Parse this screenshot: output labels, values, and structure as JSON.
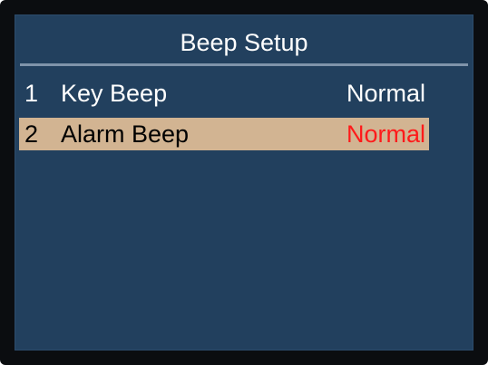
{
  "screen": {
    "title": "Beep Setup"
  },
  "menu": {
    "items": [
      {
        "number": "1",
        "label": "Key Beep",
        "value": "Normal",
        "selected": false
      },
      {
        "number": "2",
        "label": "Alarm Beep",
        "value": "Normal",
        "selected": true
      }
    ]
  },
  "colors": {
    "background": "#22405e",
    "selection_highlight": "#d2b492",
    "selected_value": "#ff1a1a",
    "text": "#ffffff"
  }
}
